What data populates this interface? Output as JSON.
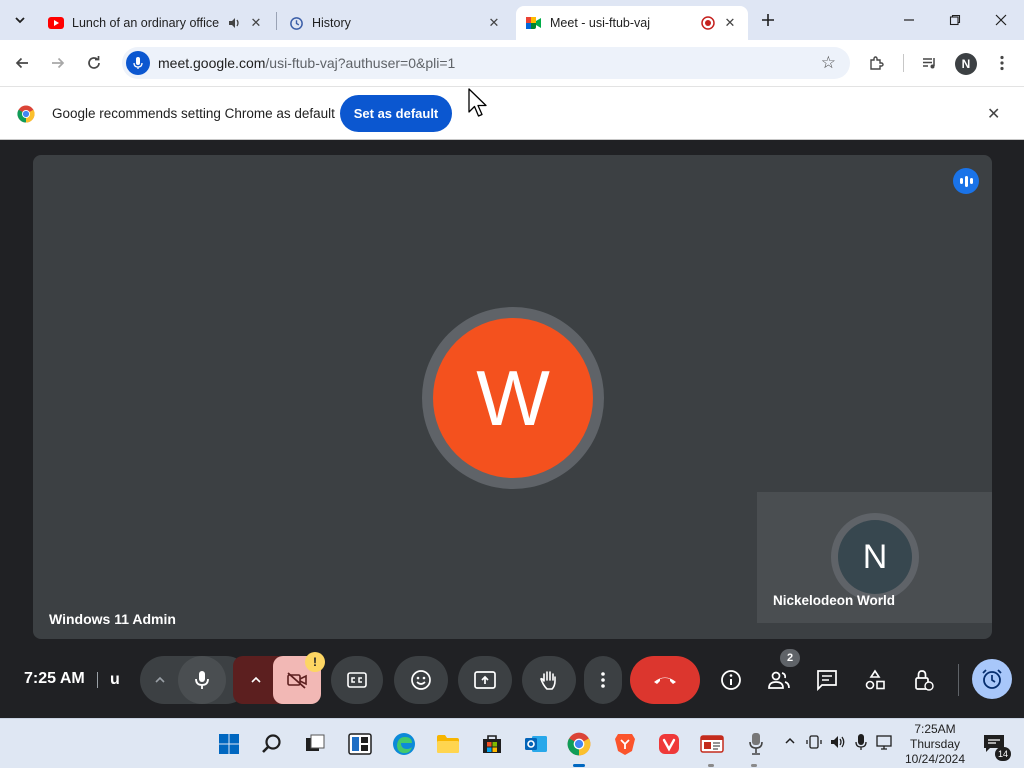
{
  "browser": {
    "tabs": [
      {
        "title": "Lunch of an ordinary office",
        "favicon": "youtube-icon",
        "audio": true
      },
      {
        "title": "History",
        "favicon": "history-icon"
      },
      {
        "title": "Meet - usi-ftub-vaj",
        "favicon": "meet-icon",
        "recording": true,
        "active": true
      }
    ],
    "url_host": "meet.google.com",
    "url_rest": "/usi-ftub-vaj?authuser=0&pli=1",
    "profile_initial": "N"
  },
  "infobar": {
    "message": "Google recommends setting Chrome as default",
    "button_label": "Set as default"
  },
  "meet": {
    "main_participant": {
      "initial": "W",
      "name": "Windows 11 Admin",
      "avatar_color": "#f4511e"
    },
    "self_participant": {
      "initial": "N",
      "name": "Nickelodeon World",
      "avatar_color": "#37474f"
    },
    "clock": "7:25 AM",
    "meeting_code": "u",
    "people_count": "2",
    "camera_warning": "!"
  },
  "taskbar": {
    "time": "7:25AM",
    "day": "Thursday",
    "date": "10/24/2024",
    "notification_count": "14"
  },
  "colors": {
    "accent_blue": "#0b57d0",
    "end_call_red": "#dc362e",
    "meet_bg": "#202124",
    "tile_bg": "#3c4043"
  }
}
